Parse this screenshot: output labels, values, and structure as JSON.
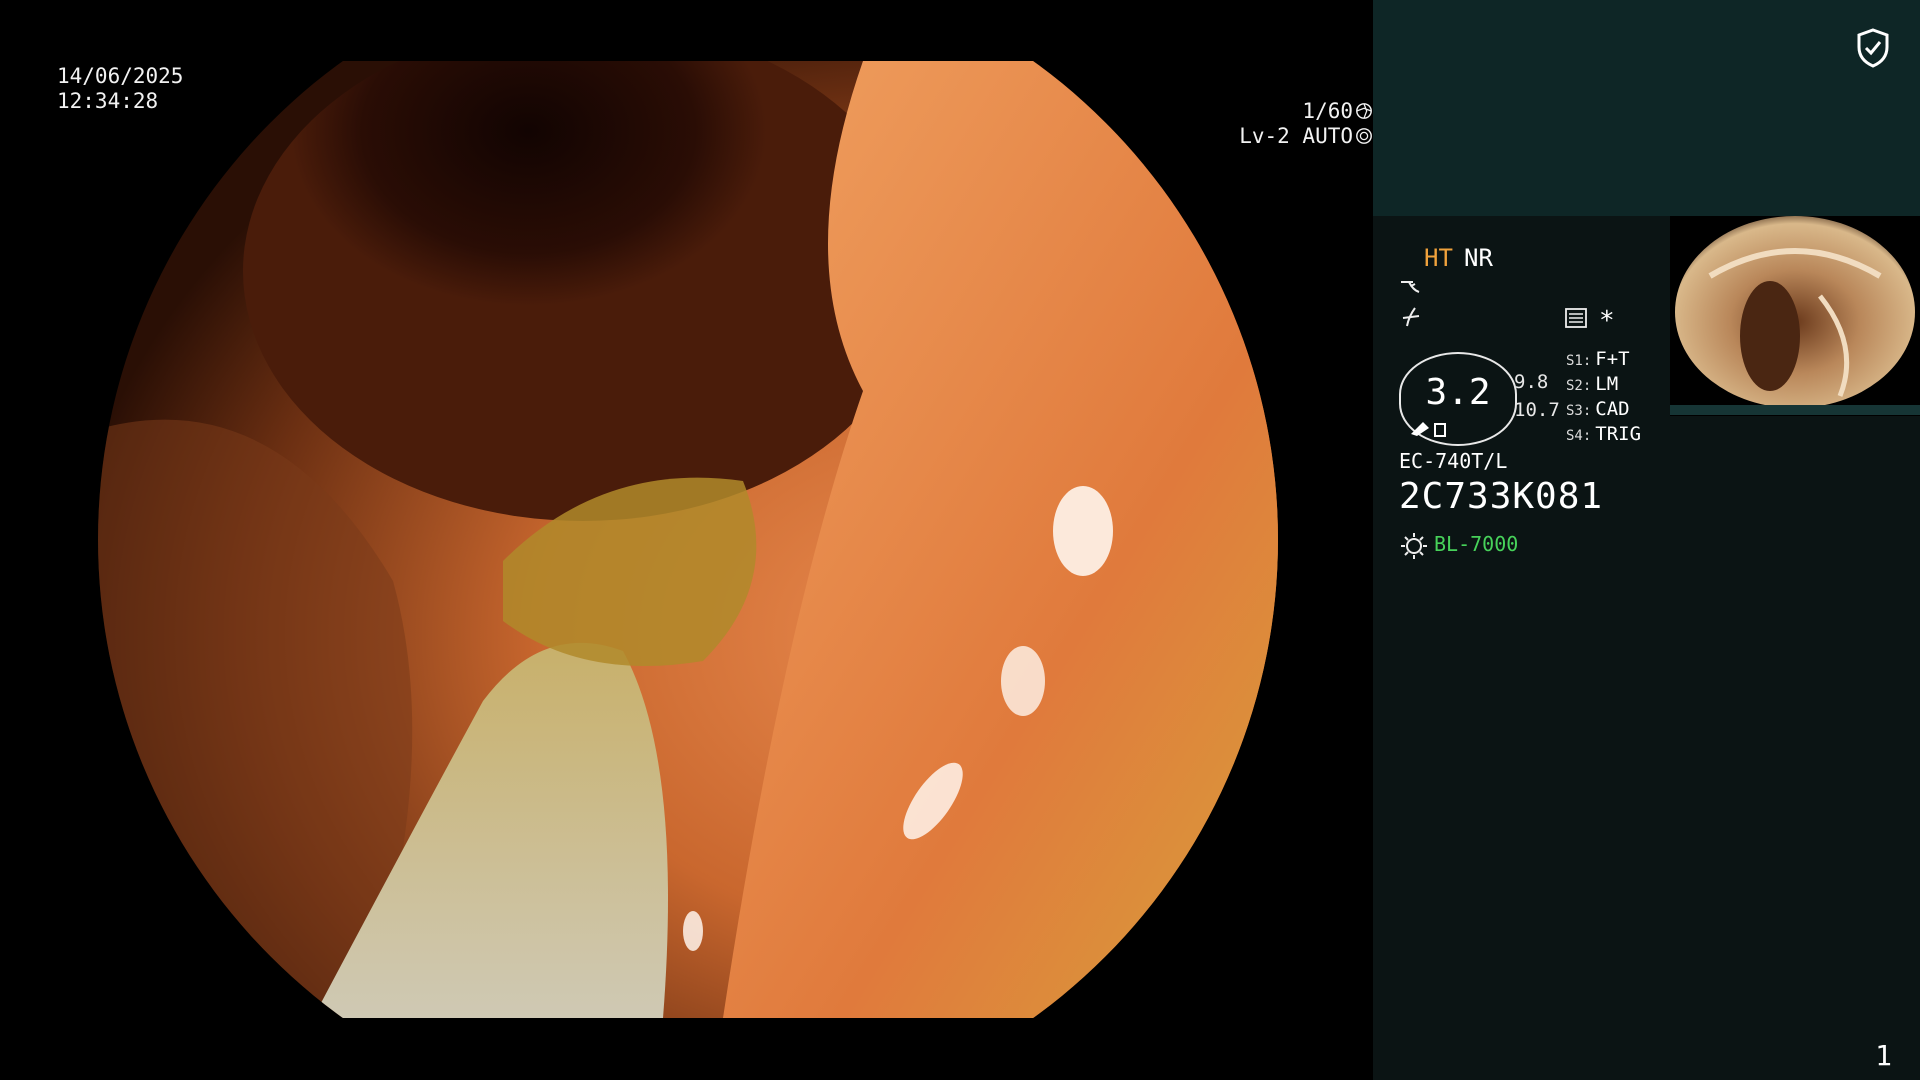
{
  "osd": {
    "date": "14/06/2025",
    "time": "12:34:28",
    "shutter": "1/60",
    "level": "Lv-2",
    "mode": "AUTO",
    "shutter_icon": "aperture-icon",
    "mode_icon": "iris-icon"
  },
  "panel": {
    "security_icon": "shield-check-icon",
    "ht_label": "HT",
    "nr_label": "NR",
    "gauge_value": "3.2",
    "gauge_top": "9.8",
    "gauge_bottom": "10.7",
    "settings": [
      {
        "key": "S1:",
        "value": "F+T"
      },
      {
        "key": "S2:",
        "value": "LM"
      },
      {
        "key": "S3:",
        "value": "CAD"
      },
      {
        "key": "S4:",
        "value": "TRIG"
      }
    ],
    "star": "*",
    "scope_model": "EC-740T/L",
    "scope_serial": "2C733K081",
    "light_source": "BL-7000",
    "page_number": "1"
  },
  "colors": {
    "panel_bg": "#0b1414",
    "panel_top_bg": "#0e2626",
    "ht": "#f0a23c",
    "light_source": "#47d25a"
  }
}
